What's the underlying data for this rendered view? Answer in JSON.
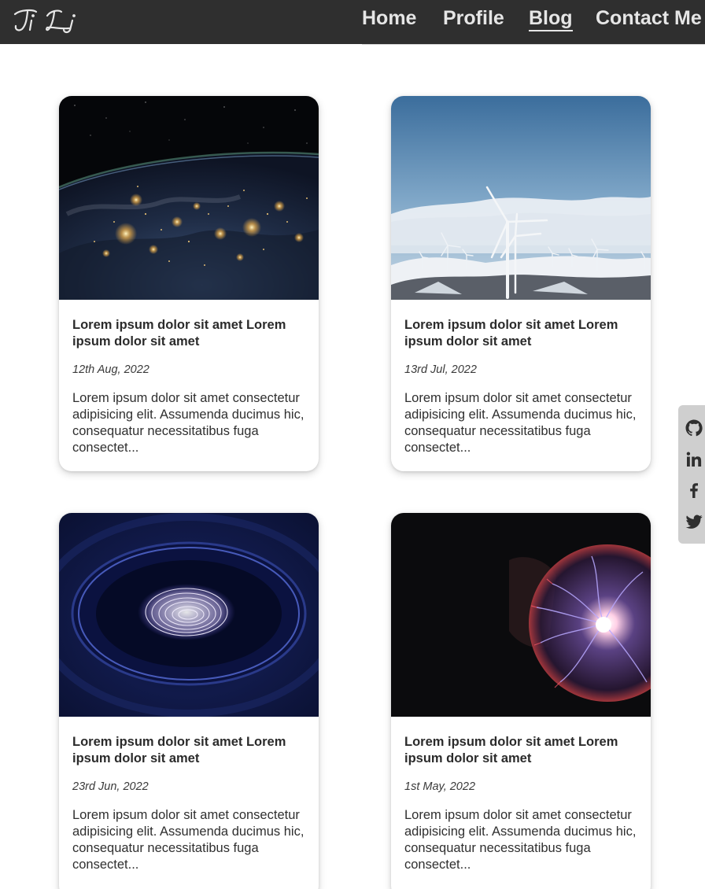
{
  "header": {
    "logo_text": "Ji Li",
    "nav": [
      {
        "label": "Home",
        "active": false
      },
      {
        "label": "Profile",
        "active": false
      },
      {
        "label": "Blog",
        "active": true
      },
      {
        "label": "Contact Me",
        "active": false
      }
    ],
    "background": "#2f2f2f",
    "text_color": "#e6e6e6"
  },
  "posts": [
    {
      "image": "earth-at-night-photo",
      "title": "Lorem ipsum dolor sit amet Lorem ipsum dolor sit amet",
      "date": "12th Aug, 2022",
      "excerpt": "Lorem ipsum dolor sit amet consectetur adipisicing elit. Assumenda ducimus hic, consequatur necessitatibus fuga consectet..."
    },
    {
      "image": "wind-turbines-photo",
      "title": "Lorem ipsum dolor sit amet Lorem ipsum dolor sit amet",
      "date": "13rd Jul, 2022",
      "excerpt": "Lorem ipsum dolor sit amet consectetur adipisicing elit. Assumenda ducimus hic, consequatur necessitatibus fuga consectet..."
    },
    {
      "image": "fingerprint-scanner-photo",
      "title": "Lorem ipsum dolor sit amet Lorem ipsum dolor sit amet",
      "date": "23rd Jun, 2022",
      "excerpt": "Lorem ipsum dolor sit amet consectetur adipisicing elit. Assumenda ducimus hic, consequatur necessitatibus fuga consectet..."
    },
    {
      "image": "plasma-ball-photo",
      "title": "Lorem ipsum dolor sit amet Lorem ipsum dolor sit amet",
      "date": "1st May, 2022",
      "excerpt": "Lorem ipsum dolor sit amet consectetur adipisicing elit. Assumenda ducimus hic, consequatur necessitatibus fuga consectet..."
    }
  ],
  "social": {
    "icons": [
      "github-icon",
      "linkedin-icon",
      "facebook-icon",
      "twitter-icon"
    ],
    "background": "#cfcfcf",
    "icon_color": "#2f2f2f"
  }
}
